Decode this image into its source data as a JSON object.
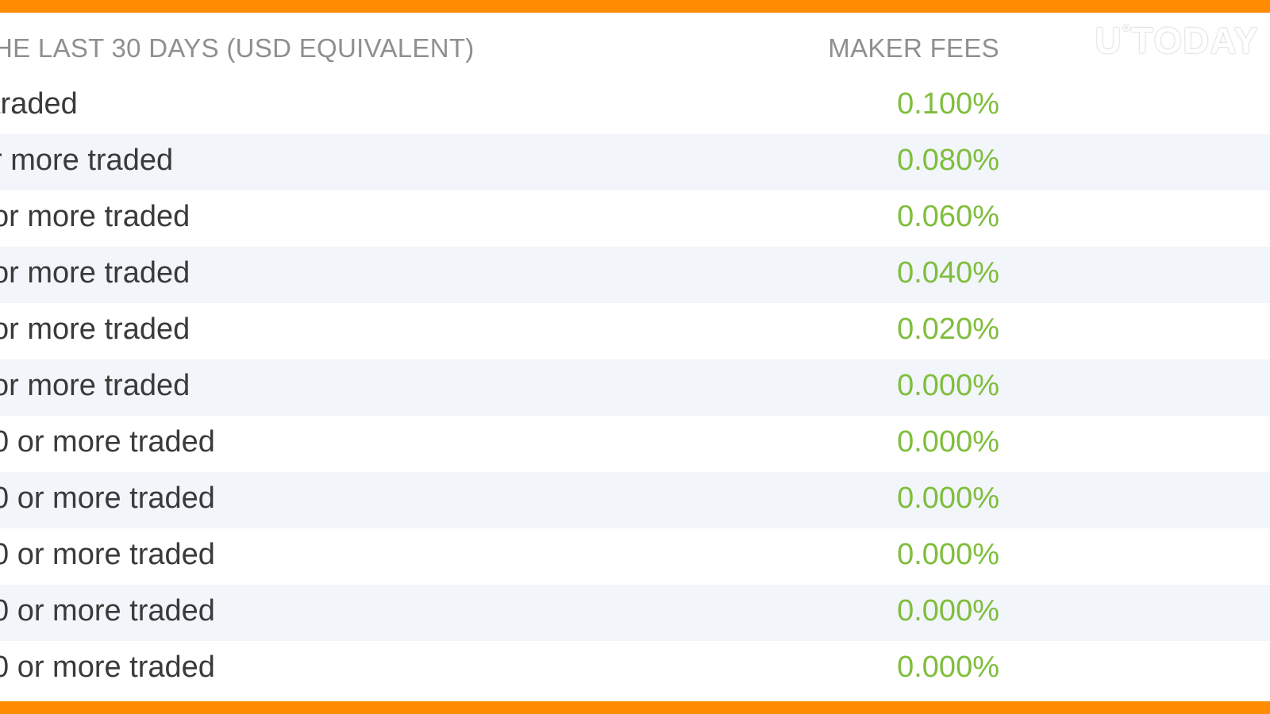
{
  "colors": {
    "accent_bar": "#ff8c00",
    "fee_text": "#7fbe3c",
    "header_text": "#8f8f8f",
    "row_text": "#3a3a3a",
    "row_alt_bg": "#f2f5fa"
  },
  "watermark": {
    "text_left": "U",
    "degree": "°",
    "text_right": "TODAY"
  },
  "table": {
    "header_volume": "HE LAST 30 DAYS (USD EQUIVALENT)",
    "header_fees": "MAKER FEES",
    "rows": [
      {
        "volume": "traded",
        "fee": "0.100%"
      },
      {
        "volume": "r more traded",
        "fee": "0.080%"
      },
      {
        "volume": " or more traded",
        "fee": "0.060%"
      },
      {
        "volume": " or more traded",
        "fee": "0.040%"
      },
      {
        "volume": " or more traded",
        "fee": "0.020%"
      },
      {
        "volume": " or more traded",
        "fee": "0.000%"
      },
      {
        "volume": "0 or more traded",
        "fee": "0.000%"
      },
      {
        "volume": "0 or more traded",
        "fee": "0.000%"
      },
      {
        "volume": "0 or more traded",
        "fee": "0.000%"
      },
      {
        "volume": "0 or more traded",
        "fee": "0.000%"
      },
      {
        "volume": "0 or more traded",
        "fee": "0.000%"
      }
    ]
  }
}
